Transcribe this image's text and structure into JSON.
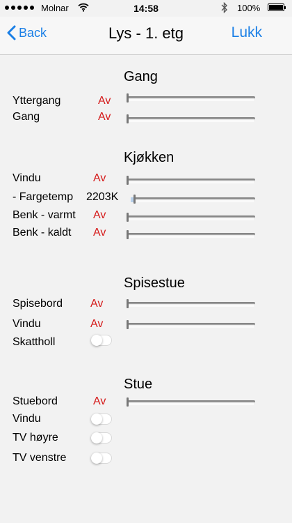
{
  "status": {
    "carrier": "Molnar",
    "time": "14:58",
    "battery": "100%"
  },
  "nav": {
    "back": "Back",
    "title": "Lys - 1. etg",
    "close": "Lukk"
  },
  "sections": {
    "gang": {
      "title": "Gang",
      "rows": [
        {
          "label": "Yttergang",
          "value": "Av",
          "level": 0
        },
        {
          "label": "Gang",
          "value": "Av",
          "level": 0
        }
      ]
    },
    "kjokken": {
      "title": "Kjøkken",
      "rows": [
        {
          "label": "Vindu",
          "value": "Av",
          "level": 0
        },
        {
          "label": "- Fargetemp",
          "value": "2203K",
          "level": 0.02
        },
        {
          "label": "Benk - varmt",
          "value": "Av",
          "level": 0
        },
        {
          "label": "Benk - kaldt",
          "value": "Av",
          "level": 0
        }
      ]
    },
    "spisestue": {
      "title": "Spisestue",
      "rows": [
        {
          "label": "Spisebord",
          "value": "Av",
          "level": 0
        },
        {
          "label": "Vindu",
          "value": "Av",
          "level": 0
        },
        {
          "label": "Skattholl",
          "toggle": false
        }
      ]
    },
    "stue": {
      "title": "Stue",
      "rows": [
        {
          "label": "Stuebord",
          "value": "Av",
          "level": 0
        },
        {
          "label": "Vindu",
          "toggle": false
        },
        {
          "label": "TV høyre",
          "toggle": false
        },
        {
          "label": "TV venstre",
          "toggle": false
        }
      ]
    }
  },
  "colors": {
    "accent": "#1a7fe6",
    "off_value": "#d51b1b",
    "background": "#f2f2f2"
  },
  "icons": {
    "back": "chevron-left-icon",
    "wifi": "wifi-icon",
    "bluetooth": "bluetooth-icon",
    "battery": "battery-icon",
    "signal": "signal-dots-icon"
  }
}
